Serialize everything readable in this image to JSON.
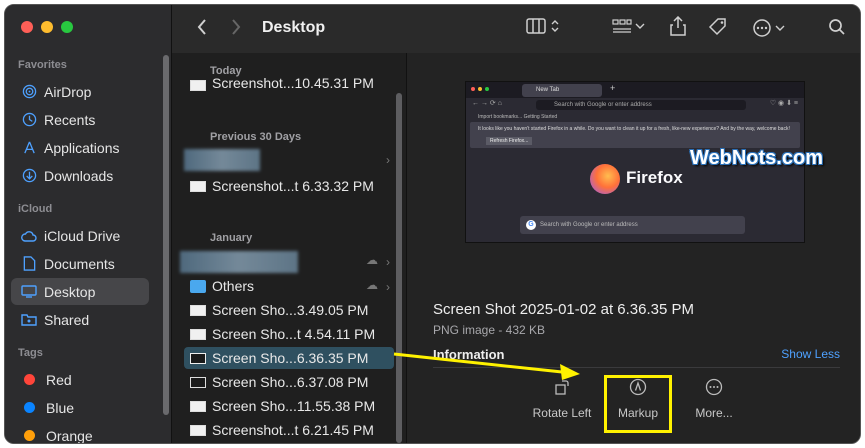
{
  "window": {
    "title": "Desktop"
  },
  "sidebar": {
    "favorites_header": "Favorites",
    "favorites": [
      {
        "label": "AirDrop",
        "icon": "airdrop-icon"
      },
      {
        "label": "Recents",
        "icon": "clock-icon"
      },
      {
        "label": "Applications",
        "icon": "applications-icon"
      },
      {
        "label": "Downloads",
        "icon": "download-icon"
      }
    ],
    "icloud_header": "iCloud",
    "icloud": [
      {
        "label": "iCloud Drive",
        "icon": "cloud-icon"
      },
      {
        "label": "Documents",
        "icon": "document-icon"
      },
      {
        "label": "Desktop",
        "icon": "desktop-icon",
        "selected": true
      },
      {
        "label": "Shared",
        "icon": "shared-folder-icon"
      }
    ],
    "tags_header": "Tags",
    "tags": [
      {
        "label": "Red",
        "color": "#ff453a"
      },
      {
        "label": "Blue",
        "color": "#0a84ff"
      },
      {
        "label": "Orange",
        "color": "#ff9f0a"
      }
    ]
  },
  "list": {
    "sections": {
      "today": "Today",
      "previous30": "Previous 30 Days",
      "january": "January"
    },
    "today_items": [
      "Screenshot...10.45.31 PM"
    ],
    "previous30_items": [
      "Screenshot...t 6.33.32 PM"
    ],
    "january_items": [
      {
        "label": "Others",
        "type": "folder"
      },
      {
        "label": "Screen Sho...3.49.05 PM",
        "type": "file"
      },
      {
        "label": "Screen Sho...t 4.54.11 PM",
        "type": "file"
      },
      {
        "label": "Screen Sho...6.36.35 PM",
        "type": "file",
        "selected": true
      },
      {
        "label": "Screen Sho...6.37.08 PM",
        "type": "file"
      },
      {
        "label": "Screen Sho...11.55.38 PM",
        "type": "file"
      },
      {
        "label": "Screenshot...t 6.21.45 PM",
        "type": "file"
      }
    ]
  },
  "preview": {
    "thumbnail": {
      "tab_label": "New Tab",
      "url_placeholder": "Search with Google or enter address",
      "bookmarks": "Import bookmarks...    Getting Started",
      "notice": "It looks like you haven't started Firefox in a while. Do you want to clean it up for a fresh, like-new experience? And by the way, welcome back!",
      "notice_button": "Refresh Firefox...",
      "wordmark": "Firefox",
      "search_placeholder": "Search with Google or enter address"
    },
    "file_title": "Screen Shot 2025-01-02 at 6.36.35 PM",
    "file_meta": "PNG image - 432 KB",
    "info_label": "Information",
    "show_less": "Show Less",
    "actions": [
      {
        "label": "Rotate Left",
        "icon": "rotate-left-icon"
      },
      {
        "label": "Markup",
        "icon": "markup-icon"
      },
      {
        "label": "More...",
        "icon": "more-icon"
      }
    ]
  },
  "watermark": "WebNots.com",
  "colors": {
    "highlight_yellow": "#fff200",
    "accent_blue": "#4ea1ff",
    "selection": "#2f5060"
  }
}
